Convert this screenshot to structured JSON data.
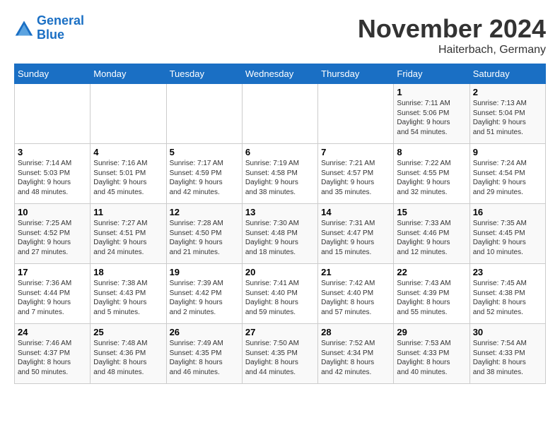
{
  "logo": {
    "line1": "General",
    "line2": "Blue"
  },
  "title": "November 2024",
  "location": "Haiterbach, Germany",
  "weekdays": [
    "Sunday",
    "Monday",
    "Tuesday",
    "Wednesday",
    "Thursday",
    "Friday",
    "Saturday"
  ],
  "weeks": [
    [
      {
        "day": "",
        "info": ""
      },
      {
        "day": "",
        "info": ""
      },
      {
        "day": "",
        "info": ""
      },
      {
        "day": "",
        "info": ""
      },
      {
        "day": "",
        "info": ""
      },
      {
        "day": "1",
        "info": "Sunrise: 7:11 AM\nSunset: 5:06 PM\nDaylight: 9 hours\nand 54 minutes."
      },
      {
        "day": "2",
        "info": "Sunrise: 7:13 AM\nSunset: 5:04 PM\nDaylight: 9 hours\nand 51 minutes."
      }
    ],
    [
      {
        "day": "3",
        "info": "Sunrise: 7:14 AM\nSunset: 5:03 PM\nDaylight: 9 hours\nand 48 minutes."
      },
      {
        "day": "4",
        "info": "Sunrise: 7:16 AM\nSunset: 5:01 PM\nDaylight: 9 hours\nand 45 minutes."
      },
      {
        "day": "5",
        "info": "Sunrise: 7:17 AM\nSunset: 4:59 PM\nDaylight: 9 hours\nand 42 minutes."
      },
      {
        "day": "6",
        "info": "Sunrise: 7:19 AM\nSunset: 4:58 PM\nDaylight: 9 hours\nand 38 minutes."
      },
      {
        "day": "7",
        "info": "Sunrise: 7:21 AM\nSunset: 4:57 PM\nDaylight: 9 hours\nand 35 minutes."
      },
      {
        "day": "8",
        "info": "Sunrise: 7:22 AM\nSunset: 4:55 PM\nDaylight: 9 hours\nand 32 minutes."
      },
      {
        "day": "9",
        "info": "Sunrise: 7:24 AM\nSunset: 4:54 PM\nDaylight: 9 hours\nand 29 minutes."
      }
    ],
    [
      {
        "day": "10",
        "info": "Sunrise: 7:25 AM\nSunset: 4:52 PM\nDaylight: 9 hours\nand 27 minutes."
      },
      {
        "day": "11",
        "info": "Sunrise: 7:27 AM\nSunset: 4:51 PM\nDaylight: 9 hours\nand 24 minutes."
      },
      {
        "day": "12",
        "info": "Sunrise: 7:28 AM\nSunset: 4:50 PM\nDaylight: 9 hours\nand 21 minutes."
      },
      {
        "day": "13",
        "info": "Sunrise: 7:30 AM\nSunset: 4:48 PM\nDaylight: 9 hours\nand 18 minutes."
      },
      {
        "day": "14",
        "info": "Sunrise: 7:31 AM\nSunset: 4:47 PM\nDaylight: 9 hours\nand 15 minutes."
      },
      {
        "day": "15",
        "info": "Sunrise: 7:33 AM\nSunset: 4:46 PM\nDaylight: 9 hours\nand 12 minutes."
      },
      {
        "day": "16",
        "info": "Sunrise: 7:35 AM\nSunset: 4:45 PM\nDaylight: 9 hours\nand 10 minutes."
      }
    ],
    [
      {
        "day": "17",
        "info": "Sunrise: 7:36 AM\nSunset: 4:44 PM\nDaylight: 9 hours\nand 7 minutes."
      },
      {
        "day": "18",
        "info": "Sunrise: 7:38 AM\nSunset: 4:43 PM\nDaylight: 9 hours\nand 5 minutes."
      },
      {
        "day": "19",
        "info": "Sunrise: 7:39 AM\nSunset: 4:42 PM\nDaylight: 9 hours\nand 2 minutes."
      },
      {
        "day": "20",
        "info": "Sunrise: 7:41 AM\nSunset: 4:40 PM\nDaylight: 8 hours\nand 59 minutes."
      },
      {
        "day": "21",
        "info": "Sunrise: 7:42 AM\nSunset: 4:40 PM\nDaylight: 8 hours\nand 57 minutes."
      },
      {
        "day": "22",
        "info": "Sunrise: 7:43 AM\nSunset: 4:39 PM\nDaylight: 8 hours\nand 55 minutes."
      },
      {
        "day": "23",
        "info": "Sunrise: 7:45 AM\nSunset: 4:38 PM\nDaylight: 8 hours\nand 52 minutes."
      }
    ],
    [
      {
        "day": "24",
        "info": "Sunrise: 7:46 AM\nSunset: 4:37 PM\nDaylight: 8 hours\nand 50 minutes."
      },
      {
        "day": "25",
        "info": "Sunrise: 7:48 AM\nSunset: 4:36 PM\nDaylight: 8 hours\nand 48 minutes."
      },
      {
        "day": "26",
        "info": "Sunrise: 7:49 AM\nSunset: 4:35 PM\nDaylight: 8 hours\nand 46 minutes."
      },
      {
        "day": "27",
        "info": "Sunrise: 7:50 AM\nSunset: 4:35 PM\nDaylight: 8 hours\nand 44 minutes."
      },
      {
        "day": "28",
        "info": "Sunrise: 7:52 AM\nSunset: 4:34 PM\nDaylight: 8 hours\nand 42 minutes."
      },
      {
        "day": "29",
        "info": "Sunrise: 7:53 AM\nSunset: 4:33 PM\nDaylight: 8 hours\nand 40 minutes."
      },
      {
        "day": "30",
        "info": "Sunrise: 7:54 AM\nSunset: 4:33 PM\nDaylight: 8 hours\nand 38 minutes."
      }
    ]
  ]
}
